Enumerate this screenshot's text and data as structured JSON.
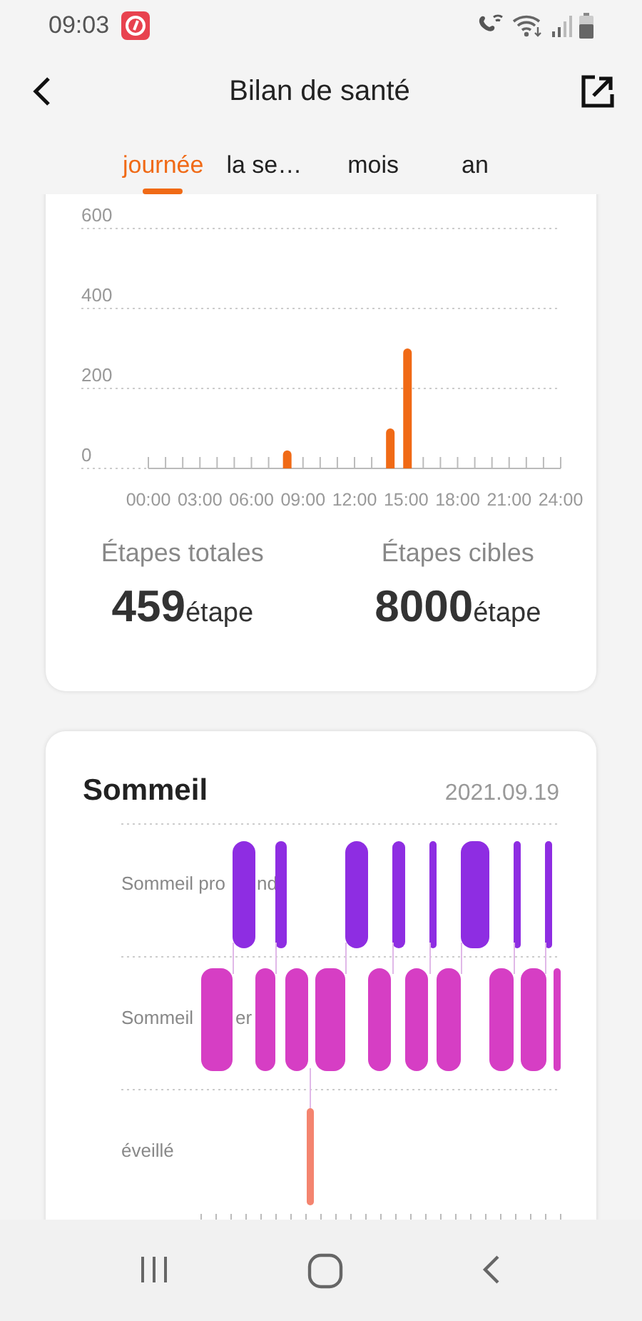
{
  "status_bar": {
    "time": "09:03"
  },
  "header": {
    "title": "Bilan de santé"
  },
  "tabs": [
    {
      "label": "journée",
      "selected": true
    },
    {
      "label": "la se…",
      "selected": false
    },
    {
      "label": "mois",
      "selected": false
    },
    {
      "label": "an",
      "selected": false
    }
  ],
  "steps_card": {
    "chart_data": {
      "type": "bar",
      "x": [
        8,
        14,
        15
      ],
      "values": [
        45,
        100,
        300
      ],
      "xlim": [
        0,
        24
      ],
      "ylim": [
        0,
        600
      ],
      "yticks": [
        0,
        200,
        400,
        600
      ],
      "xticks": [
        {
          "value": 0,
          "label": "00:00"
        },
        {
          "value": 3,
          "label": "03:00"
        },
        {
          "value": 6,
          "label": "06:00"
        },
        {
          "value": 9,
          "label": "09:00"
        },
        {
          "value": 12,
          "label": "12:00"
        },
        {
          "value": 15,
          "label": "15:00"
        },
        {
          "value": 18,
          "label": "18:00"
        },
        {
          "value": 21,
          "label": "21:00"
        },
        {
          "value": 24,
          "label": "24:00"
        }
      ]
    },
    "stats": [
      {
        "label": "Étapes totales",
        "value": "459",
        "unit": "étape"
      },
      {
        "label": "Étapes cibles",
        "value": "8000",
        "unit": "étape"
      }
    ]
  },
  "sleep_card": {
    "title": "Sommeil",
    "date": "2021.09.19",
    "levels": [
      {
        "label": "Sommeil pro",
        "tail": "nd"
      },
      {
        "label": "Sommeil",
        "tail": "er"
      },
      {
        "label": "éveillé"
      }
    ]
  }
}
